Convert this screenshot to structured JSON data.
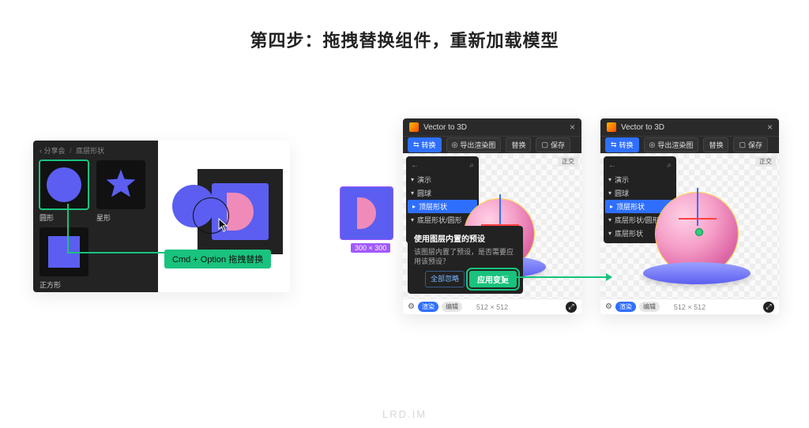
{
  "title": "第四步：拖拽替换组件，重新加载模型",
  "watermark": "LRD.IM",
  "asset_panel": {
    "breadcrumb_root": "分享会",
    "breadcrumb_current": "底层形状",
    "items": [
      {
        "label": "圆形"
      },
      {
        "label": "星形"
      },
      {
        "label": "正方形"
      }
    ]
  },
  "drag_hint": "Cmd + Option 拖拽替换",
  "mid_swatch_size": "300 × 300",
  "plugin": {
    "title": "Vector to 3D",
    "toolbar": {
      "convert": "转换",
      "export": "导出渲染图",
      "replace": "替换",
      "save": "保存"
    },
    "tag": "正交",
    "tree": {
      "scene": "演示",
      "items": [
        "圆球",
        "顶层形状",
        "底层形状/圆形",
        "底层形状"
      ]
    },
    "popup": {
      "title": "使用图层内置的预设",
      "desc": "该图层内置了预设，是否需要应用该预设？",
      "ignore": "全部忽略",
      "apply": "应用变更"
    },
    "footer": {
      "render": "渲染",
      "edit": "编辑",
      "size": "512 × 512"
    }
  }
}
